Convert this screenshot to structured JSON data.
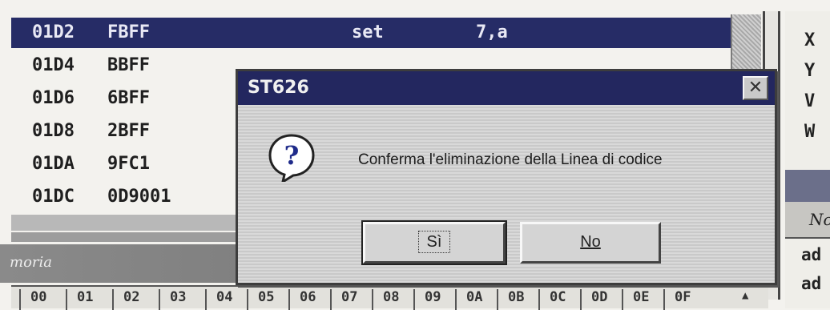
{
  "listing": {
    "rows": [
      {
        "addr": "01D2",
        "bytes": "FBFF",
        "mnemonic": "set",
        "operand": "7,a",
        "selected": true
      },
      {
        "addr": "01D4",
        "bytes": "BBFF",
        "mnemonic": "",
        "operand": ""
      },
      {
        "addr": "01D6",
        "bytes": "6BFF",
        "mnemonic": "",
        "operand": ""
      },
      {
        "addr": "01D8",
        "bytes": "2BFF",
        "mnemonic": "",
        "operand": ""
      },
      {
        "addr": "01DA",
        "bytes": "9FC1",
        "mnemonic": "",
        "operand": ""
      },
      {
        "addr": "01DC",
        "bytes": "0D9001",
        "mnemonic": "",
        "operand": ""
      }
    ]
  },
  "memory_panel": {
    "title": "moria",
    "columns": [
      "00",
      "01",
      "02",
      "03",
      "04",
      "05",
      "06",
      "07",
      "08",
      "09",
      "0A",
      "0B",
      "0C",
      "0D",
      "0E",
      "0F"
    ]
  },
  "registers": [
    "X",
    "Y",
    "V",
    "W"
  ],
  "right_panel": {
    "fragment": "No",
    "lines": [
      "ad",
      "ad"
    ]
  },
  "dialog": {
    "title": "ST626",
    "close_icon": "close-icon",
    "icon": "question-icon",
    "message": "Conferma l'eliminazione della Linea di codice",
    "buttons": {
      "yes": "Sì",
      "no": "No"
    }
  },
  "colors": {
    "title_bar": "#23275f",
    "selection": "#262c66"
  }
}
